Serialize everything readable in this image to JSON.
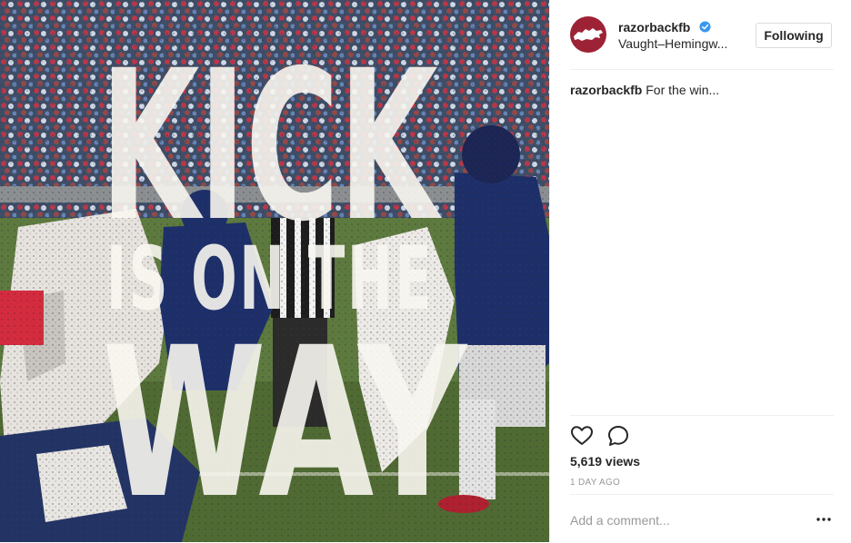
{
  "post": {
    "overlay_text": {
      "line1": "KICK",
      "line2": "IS ON THE",
      "line3": "WAY"
    }
  },
  "header": {
    "username": "razorbackfb",
    "location": "Vaught–Hemingw...",
    "follow_label": "Following"
  },
  "caption": {
    "username": "razorbackfb",
    "text": "For the win..."
  },
  "actions": {
    "like_icon": "heart-outline-icon",
    "comment_icon": "speech-bubble-icon"
  },
  "stats": {
    "views": "5,619 views",
    "timestamp": "1 DAY AGO"
  },
  "comment": {
    "placeholder": "Add a comment...",
    "more_icon": "ellipsis-icon"
  },
  "colors": {
    "brand": "#9d2235",
    "verified": "#3897f0",
    "text": "#262626",
    "muted": "#999999",
    "border": "#efefef"
  }
}
